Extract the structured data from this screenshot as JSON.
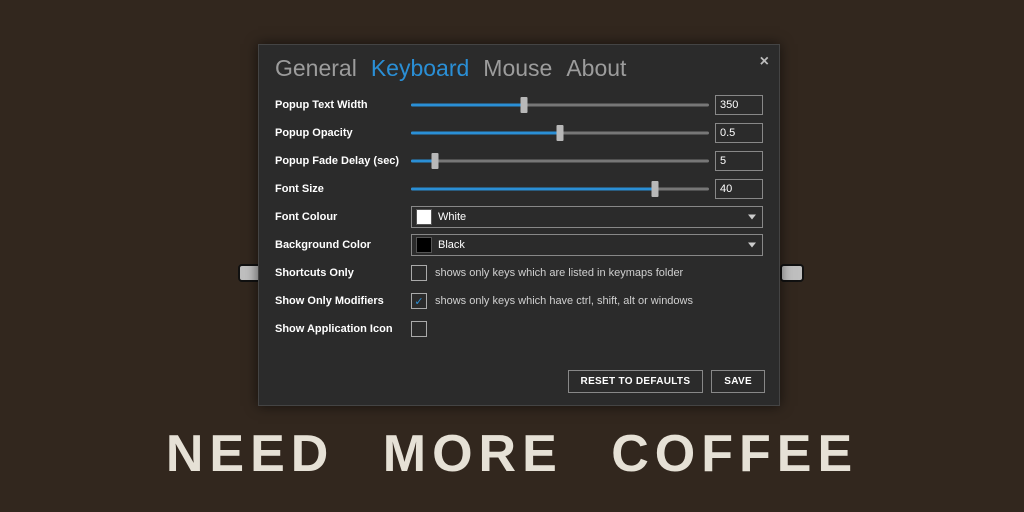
{
  "background": {
    "text": "NEED  MORE  COFFEE"
  },
  "dialog": {
    "tabs": [
      "General",
      "Keyboard",
      "Mouse",
      "About"
    ],
    "active_tab_index": 1,
    "close_glyph": "×",
    "sliders": {
      "popupTextWidth": {
        "label": "Popup Text Width",
        "value": "350",
        "fill_pct": 38
      },
      "popupOpacity": {
        "label": "Popup Opacity",
        "value": "0.5",
        "fill_pct": 50
      },
      "popupFadeDelay": {
        "label": "Popup Fade Delay (sec)",
        "value": "5",
        "fill_pct": 8
      },
      "fontSize": {
        "label": "Font Size",
        "value": "40",
        "fill_pct": 82
      }
    },
    "selects": {
      "fontColour": {
        "label": "Font Colour",
        "value": "White",
        "swatch": "#ffffff"
      },
      "backgroundColor": {
        "label": "Background Color",
        "value": "Black",
        "swatch": "#000000"
      }
    },
    "checks": {
      "shortcutsOnly": {
        "label": "Shortcuts Only",
        "checked": false,
        "hint": "shows only keys which are listed in keymaps folder"
      },
      "showOnlyModifiers": {
        "label": "Show Only Modifiers",
        "checked": true,
        "hint": "shows only keys which have ctrl, shift, alt or windows"
      },
      "showAppIcon": {
        "label": "Show Application Icon",
        "checked": false,
        "hint": ""
      }
    },
    "buttons": {
      "reset": "RESET TO DEFAULTS",
      "save": "SAVE"
    }
  }
}
